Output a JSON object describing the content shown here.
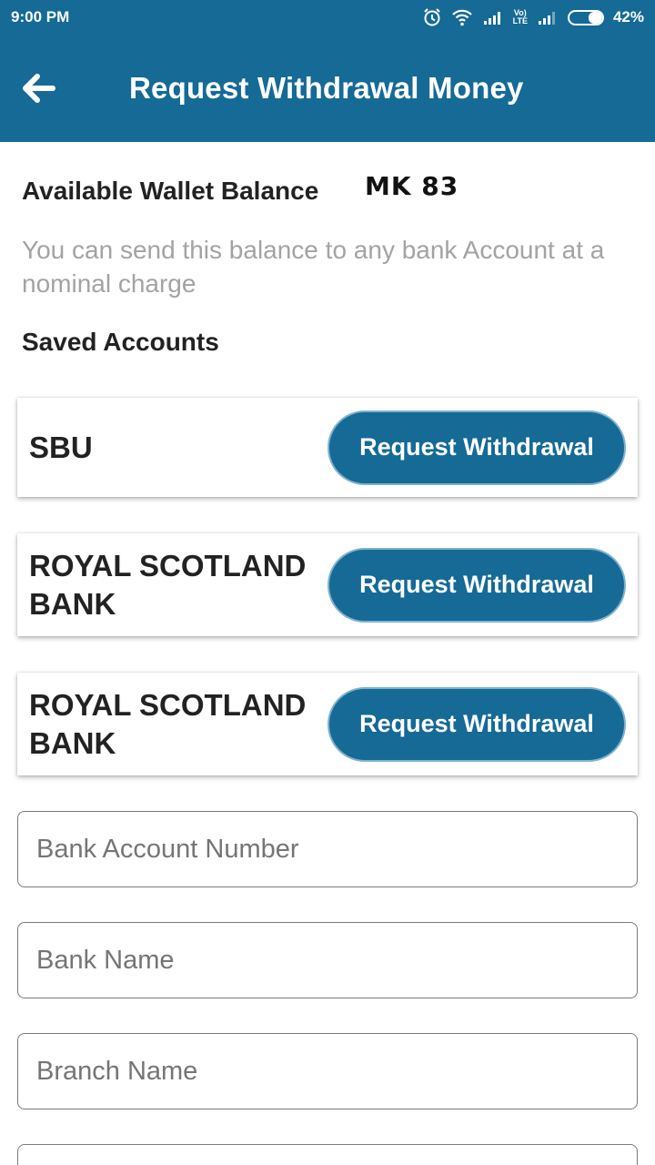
{
  "status_bar": {
    "time": "9:00 PM",
    "battery_text": "42%",
    "battery_level": 0.42,
    "icons": [
      "alarm-icon",
      "wifi-icon",
      "signal-icon",
      "volte-icon",
      "signal-icon",
      "battery-icon"
    ],
    "volte_top": "Vo)",
    "volte_bottom": "LTE"
  },
  "app_bar": {
    "title": "Request Withdrawal Money",
    "back_icon": "arrow-left-icon"
  },
  "balance": {
    "label": "Available Wallet Balance",
    "value": "MK 83"
  },
  "info_text": "You can send this balance to any bank Account at a nominal charge",
  "saved_accounts": {
    "title": "Saved Accounts",
    "items": [
      {
        "name": "SBU",
        "button_label": "Request Withdrawal"
      },
      {
        "name": "ROYAL SCOTLAND BANK",
        "button_label": "Request Withdrawal"
      },
      {
        "name": "ROYAL SCOTLAND BANK",
        "button_label": "Request Withdrawal"
      }
    ]
  },
  "form": {
    "account_number": {
      "value": "",
      "placeholder": "Bank Account Number"
    },
    "bank_name": {
      "value": "",
      "placeholder": "Bank Name"
    },
    "branch_name": {
      "value": "",
      "placeholder": "Branch Name"
    },
    "next_field": {
      "value": "",
      "placeholder": ""
    }
  },
  "colors": {
    "primary": "#156a96",
    "button_border": "#7fb2cd",
    "muted_text": "#a3a3a3"
  }
}
